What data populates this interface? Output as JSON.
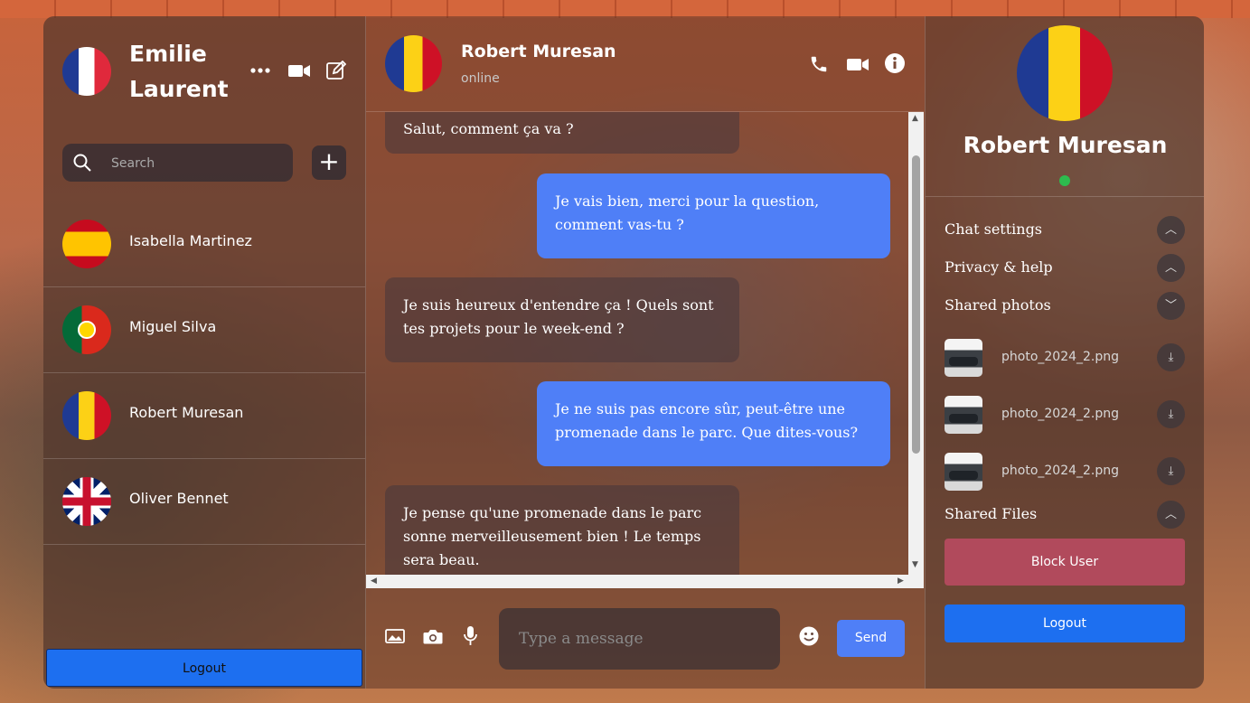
{
  "current_user": {
    "name": "Emilie Laurent",
    "flag": "france-flag"
  },
  "search": {
    "placeholder": "Search"
  },
  "contacts": [
    {
      "name": "Isabella Martinez",
      "flag": "spain-flag"
    },
    {
      "name": "Miguel Silva",
      "flag": "portugal-flag"
    },
    {
      "name": "Robert Muresan",
      "flag": "romania-flag"
    },
    {
      "name": "Oliver Bennet",
      "flag": "uk-flag"
    }
  ],
  "sidebar": {
    "logout_label": "Logout",
    "add_icon": "+"
  },
  "chat": {
    "name": "Robert Muresan",
    "status": "online",
    "messages": [
      {
        "dir": "in",
        "text": "Salut, comment ça va ?"
      },
      {
        "dir": "out",
        "text": "Je vais bien, merci pour la question, comment vas-tu ?"
      },
      {
        "dir": "in",
        "text": "Je suis heureux d'entendre ça ! Quels sont tes projets pour le week-end ?"
      },
      {
        "dir": "out",
        "text": "Je ne suis pas encore sûr, peut-être une promenade dans le parc. Que dites-vous?"
      },
      {
        "dir": "in",
        "text": "Je pense qu'une promenade dans le parc sonne merveilleusement bien ! Le temps sera beau."
      }
    ],
    "input_placeholder": "Type a message",
    "send_label": "Send"
  },
  "profile": {
    "name": "Robert Muresan",
    "online_color": "#2dbb4e",
    "sections": {
      "chat_settings": "Chat settings",
      "privacy_help": "Privacy & help",
      "shared_photos": "Shared photos",
      "shared_files": "Shared Files"
    },
    "photos": [
      {
        "name": "photo_2024_2.png"
      },
      {
        "name": "photo_2024_2.png"
      },
      {
        "name": "photo_2024_2.png"
      }
    ],
    "block_label": "Block User",
    "logout_label": "Logout"
  },
  "colors": {
    "accent": "#4f7ff7",
    "logout": "#1d6ff0",
    "block": "#b14a5c"
  }
}
